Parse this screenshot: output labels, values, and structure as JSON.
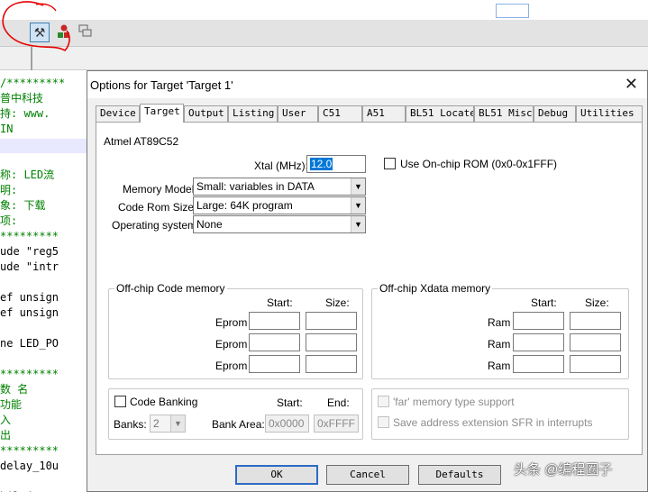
{
  "ide": {
    "toolbar_icons": [
      "wand-icon",
      "target-options-icon",
      "manage-icon"
    ],
    "code_lines": [
      {
        "text": "/*********",
        "cls": "g"
      },
      {
        "text": " 普中科技",
        "cls": "g"
      },
      {
        "text": " 持: www.",
        "cls": "g"
      },
      {
        "text": "IN",
        "cls": "g"
      },
      {
        "text": "",
        "cls": "g"
      },
      {
        "text": "",
        "cls": "g"
      },
      {
        "text": "称: LED流",
        "cls": "g"
      },
      {
        "text": "明:",
        "cls": "g"
      },
      {
        "text": "象: 下载",
        "cls": "g"
      },
      {
        "text": "项:",
        "cls": "g"
      },
      {
        "text": "*********",
        "cls": "g"
      },
      {
        "text": "ude \"reg5",
        "cls": "k"
      },
      {
        "text": "ude \"intr",
        "cls": "k"
      },
      {
        "text": "",
        "cls": "k"
      },
      {
        "text": "ef unsign",
        "cls": "k"
      },
      {
        "text": "ef unsign",
        "cls": "k"
      },
      {
        "text": "",
        "cls": "k"
      },
      {
        "text": "ne LED_PO",
        "cls": "k"
      },
      {
        "text": "",
        "cls": "k"
      },
      {
        "text": "*********",
        "cls": "g"
      },
      {
        "text": "数 名",
        "cls": "g"
      },
      {
        "text": "功能",
        "cls": "g"
      },
      {
        "text": "  入",
        "cls": "g"
      },
      {
        "text": "  出",
        "cls": "g"
      },
      {
        "text": "*********",
        "cls": "g"
      },
      {
        "text": "delay_10u",
        "cls": "k"
      },
      {
        "text": "",
        "cls": "k"
      },
      {
        "text": "hile(ten_",
        "cls": "k"
      }
    ]
  },
  "dialog": {
    "title": "Options for Target 'Target 1'",
    "close_glyph": "✕",
    "tabs": [
      "Device",
      "Target",
      "Output",
      "Listing",
      "User",
      "C51",
      "A51",
      "BL51 Locate",
      "BL51 Misc",
      "Debug",
      "Utilities"
    ],
    "selected_tab": "Target",
    "device_name": "Atmel AT89C52",
    "xtal_label": "Xtal (MHz):",
    "xtal_value": "12.0",
    "use_onchip_rom_label": "Use On-chip ROM (0x0-0x1FFF)",
    "use_onchip_rom_checked": false,
    "memory_model_label": "Memory Model:",
    "memory_model_value": "Small: variables in DATA",
    "code_rom_size_label": "Code Rom Size:",
    "code_rom_size_value": "Large: 64K program",
    "os_label": "Operating system:",
    "os_value": "None",
    "offchip_code": {
      "legend": "Off-chip Code memory",
      "start_header": "Start:",
      "size_header": "Size:",
      "rows": [
        {
          "label": "Eprom",
          "start": "",
          "size": ""
        },
        {
          "label": "Eprom",
          "start": "",
          "size": ""
        },
        {
          "label": "Eprom",
          "start": "",
          "size": ""
        }
      ]
    },
    "offchip_xdata": {
      "legend": "Off-chip Xdata memory",
      "start_header": "Start:",
      "size_header": "Size:",
      "rows": [
        {
          "label": "Ram",
          "start": "",
          "size": ""
        },
        {
          "label": "Ram",
          "start": "",
          "size": ""
        },
        {
          "label": "Ram",
          "start": "",
          "size": ""
        }
      ]
    },
    "code_banking": {
      "label": "Code Banking",
      "checked": false,
      "start_header": "Start:",
      "end_header": "End:",
      "banks_label": "Banks:",
      "banks_value": "2",
      "bank_area_label": "Bank Area:",
      "bank_area_start": "0x0000",
      "bank_area_end": "0xFFFF"
    },
    "far_memory_label": "'far' memory type support",
    "save_sfr_label": "Save address extension SFR in interrupts",
    "buttons": {
      "ok": "OK",
      "cancel": "Cancel",
      "defaults": "Defaults"
    }
  },
  "watermark": "头条 @编程圈子",
  "colors": {
    "accent": "#0078d7",
    "annotation_red": "#e60000",
    "comment_green": "#008000"
  }
}
